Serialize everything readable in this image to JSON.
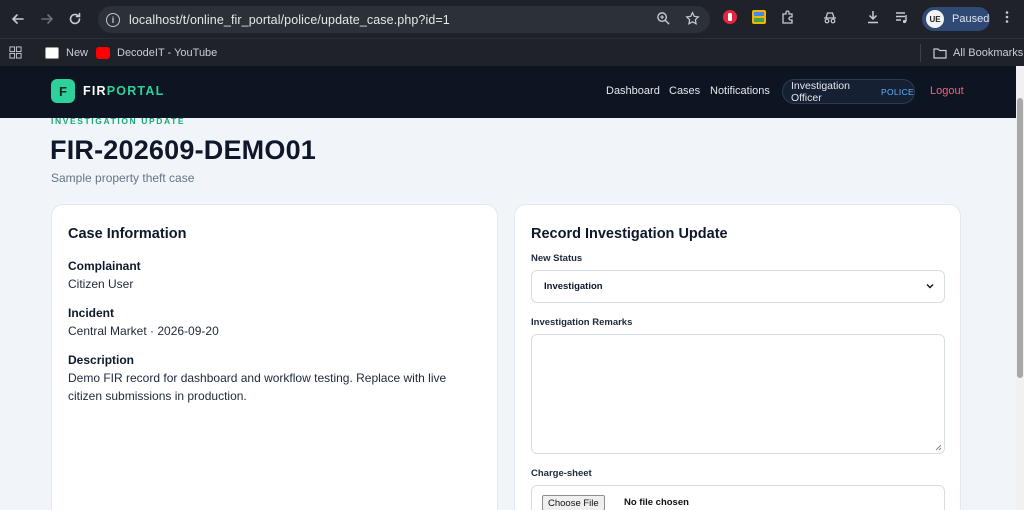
{
  "browser": {
    "url": "localhost/t/online_fir_portal/police/update_case.php?id=1",
    "profile_initials": "UE",
    "profile_status": "Paused",
    "bookmarks": {
      "new_label": "New",
      "youtube_label": "DecodeIT - YouTube",
      "all_bookmarks_label": "All Bookmarks"
    }
  },
  "app": {
    "logo_letter": "F",
    "brand_primary": "FIR",
    "brand_accent": "PORTAL",
    "nav": {
      "dashboard": "Dashboard",
      "cases": "Cases",
      "notifications": "Notifications"
    },
    "role": "Investigation Officer",
    "role_tag": "POLICE",
    "logout": "Logout"
  },
  "page": {
    "eyebrow": "INVESTIGATION UPDATE",
    "case_number": "FIR-202609-DEMO01",
    "subtitle": "Sample property theft case"
  },
  "case_info": {
    "heading": "Case Information",
    "complainant_label": "Complainant",
    "complainant_value": "Citizen User",
    "incident_label": "Incident",
    "incident_value": "Central Market · 2026-09-20",
    "description_label": "Description",
    "description_value": "Demo FIR record for dashboard and workflow testing. Replace with live citizen submissions in production."
  },
  "update_form": {
    "heading": "Record Investigation Update",
    "status_label": "New Status",
    "status_value": "Investigation",
    "remarks_label": "Investigation Remarks",
    "remarks_value": "",
    "chargesheet_label": "Charge-sheet",
    "file_button": "Choose File",
    "file_status": "No file chosen"
  },
  "colors": {
    "accent": "#2fd19b",
    "nav_bg": "#0d1522",
    "logout": "#f0627a",
    "role_tag": "#5fb3ff",
    "page_bg": "#f1f5f9"
  }
}
